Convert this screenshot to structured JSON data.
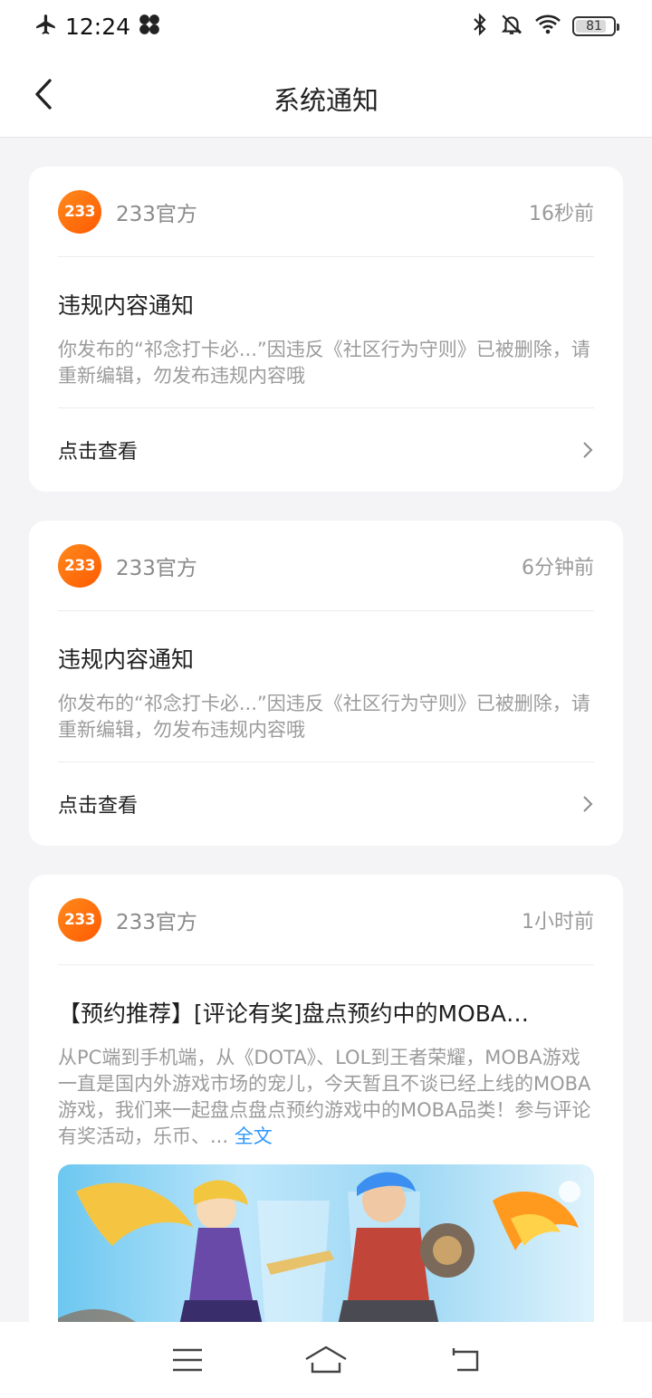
{
  "status": {
    "time": "12:24",
    "battery": "81"
  },
  "header": {
    "title": "系统通知"
  },
  "notifications": [
    {
      "sender": "233官方",
      "logo_text": "233",
      "time": "16秒前",
      "title": "违规内容通知",
      "text": "你发布的“祁念打卡必...”因违反《社区行为守则》已被删除，请重新编辑，勿发布违规内容哦",
      "action": "点击查看"
    },
    {
      "sender": "233官方",
      "logo_text": "233",
      "time": "6分钟前",
      "title": "违规内容通知",
      "text": "你发布的“祁念打卡必...”因违反《社区行为守则》已被删除，请重新编辑，勿发布违规内容哦",
      "action": "点击查看"
    },
    {
      "sender": "233官方",
      "logo_text": "233",
      "time": "1小时前",
      "title": "【预约推荐】[评论有奖]盘点预约中的MOBA…",
      "text": "从PC端到手机端，从《DOTA》、LOL到王者荣耀，MOBA游戏一直是国内外游戏市场的宠儿，今天暂且不谈已经上线的MOBA游戏，我们来一起盘点盘点预约游戏中的MOBA品类！参与评论有奖活动，乐币、... ",
      "fulltext": "全文"
    }
  ],
  "colors": {
    "accent": "#2b97ff",
    "logo": "#ff6a00"
  }
}
